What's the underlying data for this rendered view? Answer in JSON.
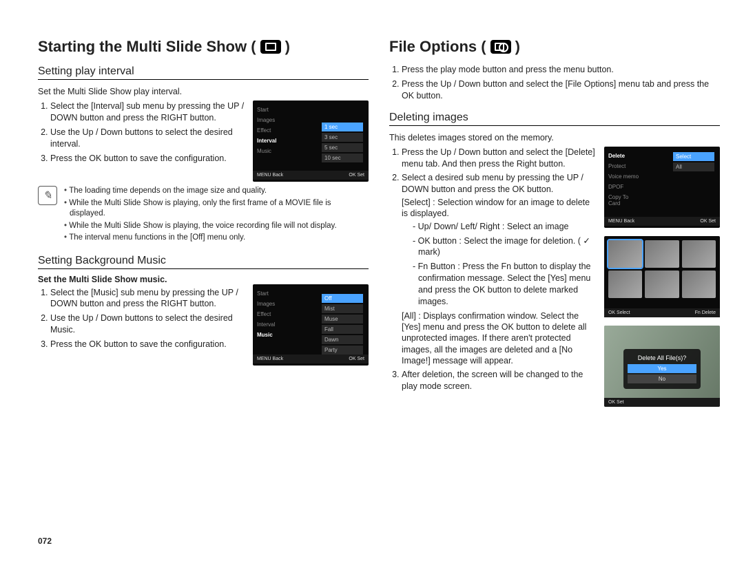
{
  "page_number": "072",
  "left": {
    "title": "Starting the Multi Slide Show (",
    "title_tail": ")",
    "sec1": {
      "heading": "Setting play interval",
      "intro": "Set the Multi Slide Show play interval.",
      "steps": [
        "Select the [Interval] sub menu by pressing the UP / DOWN button and press the RIGHT button.",
        "Use the Up / Down buttons to select the desired interval.",
        "Press the OK button to save the configuration."
      ],
      "screen": {
        "menu": [
          "Start",
          "Images",
          "Effect",
          "Interval",
          "Music"
        ],
        "highlight": "Interval",
        "options": [
          "1 sec",
          "3 sec",
          "5 sec",
          "10 sec"
        ],
        "selected": "1 sec",
        "footer_left": "MENU Back",
        "footer_right": "OK Set"
      },
      "notes": [
        "The loading time depends on the image size and quality.",
        "While the Multi Slide Show is playing, only the first frame of a MOVIE file is displayed.",
        "While the Multi Slide Show is playing, the voice recording file will not display.",
        "The interval menu functions in the [Off] menu only."
      ]
    },
    "sec2": {
      "heading": "Setting Background Music",
      "intro": "Set the Multi Slide Show music.",
      "steps": [
        "Select the [Music] sub menu by pressing the UP / DOWN button and press the RIGHT button.",
        "Use the Up / Down buttons to select the desired Music.",
        "Press the OK button to save the configuration."
      ],
      "screen": {
        "menu": [
          "Start",
          "Images",
          "Effect",
          "Interval",
          "Music"
        ],
        "highlight": "Music",
        "options": [
          "Off",
          "Mist",
          "Muse",
          "Fall",
          "Dawn",
          "Party"
        ],
        "selected": "Off",
        "footer_left": "MENU Back",
        "footer_right": "OK Set"
      }
    }
  },
  "right": {
    "title": "File Options (",
    "title_tail": ")",
    "intro_steps": [
      "Press the play mode button and press the menu button.",
      "Press the Up / Down button and select the [File Options] menu tab and press the OK button."
    ],
    "sec1": {
      "heading": "Deleting images",
      "intro": "This deletes images stored on the memory.",
      "step1": "Press the Up / Down button and select the [Delete] menu tab. And then press the Right button.",
      "step2": "Select a desired sub menu by pressing the UP / DOWN button and press the OK button.",
      "select_line": "[Select] : Selection window for an image to delete is displayed.",
      "select_subs": [
        "Up/ Down/ Left/ Right : Select an image",
        "OK button : Select the image for deletion. ( ✓ mark)",
        "Fn Button : Press the Fn button to display the confirmation message. Select the [Yes] menu and press the OK button to delete marked images."
      ],
      "all_line": "[All] : Displays confirmation window. Select the [Yes] menu and press the OK button to delete all unprotected images. If there aren't protected images, all the images are deleted and a [No Image!] message will appear.",
      "step3": "After deletion, the screen will be changed to the play mode screen.",
      "screen1": {
        "menu": [
          "Delete",
          "Protect",
          "Voice memo",
          "DPOF",
          "Copy To Card"
        ],
        "highlight": "Delete",
        "options": [
          "Select",
          "All"
        ],
        "selected": "Select",
        "footer_left": "MENU Back",
        "footer_right": "OK Set"
      },
      "screen2": {
        "footer_left": "OK Select",
        "footer_right": "Fn Delete"
      },
      "screen3": {
        "question": "Delete All File(s)?",
        "yes": "Yes",
        "no": "No",
        "footer": "OK Set"
      }
    }
  }
}
